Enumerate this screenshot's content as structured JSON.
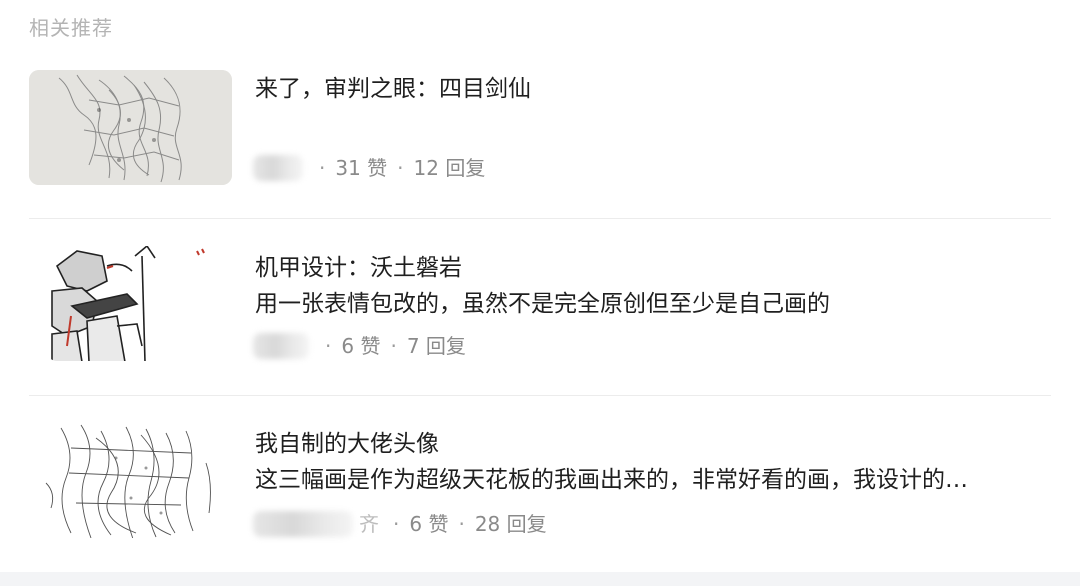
{
  "section": {
    "title": "相关推荐"
  },
  "items": [
    {
      "title": "来了，审判之眼：四目剑仙",
      "description": "",
      "author_suffix": "",
      "likes": "31 赞",
      "replies": "12 回复"
    },
    {
      "title": "机甲设计：沃土磐岩",
      "description": "用一张表情包改的，虽然不是完全原创但至少是自己画的",
      "author_suffix": "",
      "likes": "6 赞",
      "replies": "7 回复"
    },
    {
      "title": "我自制的大佬头像",
      "description": "这三幅画是作为超级天花板的我画出来的，非常好看的画，我设计的…",
      "author_suffix": "齐",
      "likes": "6 赞",
      "replies": "28 回复"
    }
  ],
  "separator": "·"
}
